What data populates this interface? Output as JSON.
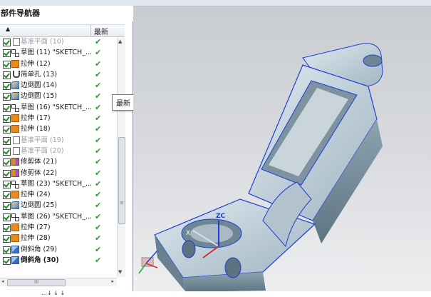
{
  "navigator": {
    "title": "部件导航器",
    "columns": {
      "sort_icon": "▲",
      "latest": "最新"
    },
    "rows": [
      {
        "icon": "datum",
        "label": "基准平面 (10)",
        "dim": true
      },
      {
        "icon": "sketch",
        "label": "草图 (11) \"SKETCH_..."
      },
      {
        "icon": "extrude",
        "label": "拉伸 (12)"
      },
      {
        "icon": "hole",
        "label": "简单孔 (13)"
      },
      {
        "icon": "blend",
        "label": "边倒圆 (14)"
      },
      {
        "icon": "blend",
        "label": "边倒圆 (15)"
      },
      {
        "icon": "sketch",
        "label": "草图 (16) \"SKETCH_..."
      },
      {
        "icon": "extrude",
        "label": "拉伸 (17)"
      },
      {
        "icon": "extrude",
        "label": "拉伸 (18)"
      },
      {
        "icon": "datum",
        "label": "基准平面 (19)",
        "dim": true
      },
      {
        "icon": "datum",
        "label": "基准平面 (20)",
        "dim": true
      },
      {
        "icon": "trim",
        "label": "修剪体 (21)"
      },
      {
        "icon": "trim",
        "label": "修剪体 (22)"
      },
      {
        "icon": "sketch",
        "label": "草图 (23) \"SKETCH_..."
      },
      {
        "icon": "extrude",
        "label": "拉伸 (24)"
      },
      {
        "icon": "blend",
        "label": "边倒圆 (25)"
      },
      {
        "icon": "sketch",
        "label": "草图 (26) \"SKETCH_..."
      },
      {
        "icon": "extrude",
        "label": "拉伸 (27)"
      },
      {
        "icon": "extrude",
        "label": "拉伸 (28)"
      },
      {
        "icon": "chamfer",
        "label": "倒斜角 (29)"
      },
      {
        "icon": "chamfer",
        "label": "倒斜角 (30)",
        "bold": true
      }
    ],
    "latest_mark": "✔"
  },
  "tooltip": "最新",
  "scrollbar": {
    "up": "▲",
    "down": "▼",
    "left": "◂",
    "right": "▸",
    "grip_v": "≡",
    "grip_h": "III"
  },
  "viewport": {
    "axis_labels": {
      "x": "X",
      "y": "Y",
      "zc": "ZC"
    },
    "model_color": "#b8cad4",
    "edge_color": "#1d3fd6"
  },
  "status": "…↓ ↓ ↓"
}
